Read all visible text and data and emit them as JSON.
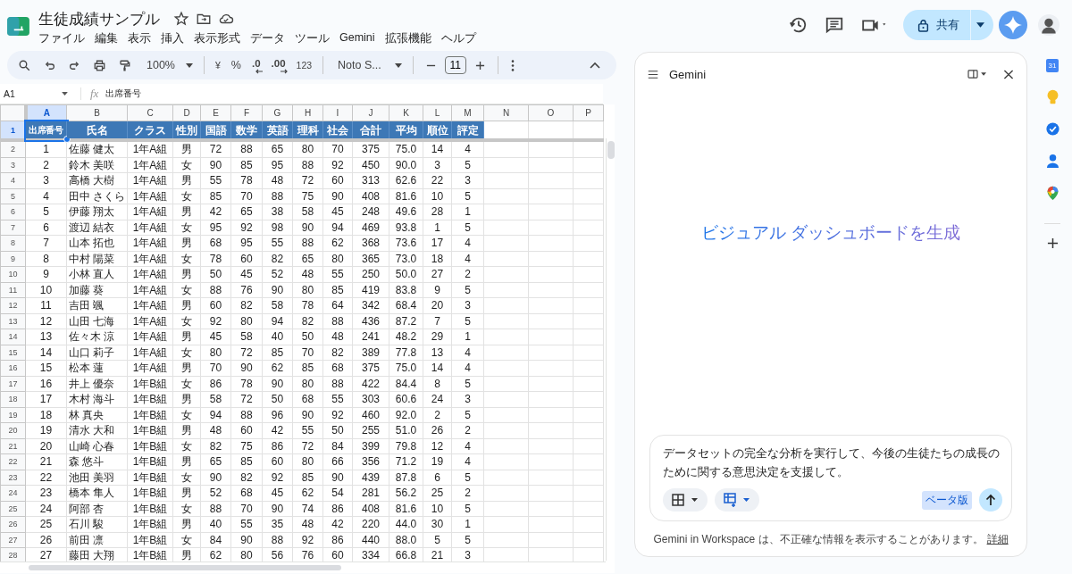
{
  "document": {
    "title": "生徒成績サンプル"
  },
  "menu": [
    "ファイル",
    "編集",
    "表示",
    "挿入",
    "表示形式",
    "データ",
    "ツール",
    "Gemini",
    "拡張機能",
    "ヘルプ"
  ],
  "share": {
    "label": "共有"
  },
  "toolbar": {
    "zoom": "100%",
    "currency": "¥",
    "percent": "%",
    "decrease_decimal": ".0",
    "increase_decimal": ".00",
    "number_format": "123",
    "font": "Noto S...",
    "font_size": "11"
  },
  "formula_bar": {
    "cell_ref": "A1",
    "fx": "fx",
    "value": "出席番号"
  },
  "sheet": {
    "columns": [
      {
        "letter": "A",
        "selected": true
      },
      {
        "letter": "B",
        "selected": false
      },
      {
        "letter": "C",
        "selected": false
      },
      {
        "letter": "D",
        "selected": false
      },
      {
        "letter": "E",
        "selected": false
      },
      {
        "letter": "F",
        "selected": false
      },
      {
        "letter": "G",
        "selected": false
      },
      {
        "letter": "H",
        "selected": false
      },
      {
        "letter": "I",
        "selected": false
      },
      {
        "letter": "J",
        "selected": false
      },
      {
        "letter": "K",
        "selected": false
      },
      {
        "letter": "L",
        "selected": false
      },
      {
        "letter": "M",
        "selected": false
      },
      {
        "letter": "N",
        "selected": false
      },
      {
        "letter": "O",
        "selected": false
      },
      {
        "letter": "P",
        "selected": false
      }
    ],
    "header": {
      "number": "1",
      "selected": true,
      "cells": [
        "出席番号",
        "氏名",
        "クラス",
        "性別",
        "国語",
        "数学",
        "英語",
        "理科",
        "社会",
        "合計",
        "平均",
        "順位",
        "評定"
      ]
    },
    "rows": [
      {
        "number": "2",
        "selected": false,
        "cells": [
          "1",
          "佐藤 健太",
          "1年A組",
          "男",
          "72",
          "88",
          "65",
          "80",
          "70",
          "375",
          "75.0",
          "14",
          "4"
        ]
      },
      {
        "number": "3",
        "selected": false,
        "cells": [
          "2",
          "鈴木 美咲",
          "1年A組",
          "女",
          "90",
          "85",
          "95",
          "88",
          "92",
          "450",
          "90.0",
          "3",
          "5"
        ]
      },
      {
        "number": "4",
        "selected": false,
        "cells": [
          "3",
          "高橋 大樹",
          "1年A組",
          "男",
          "55",
          "78",
          "48",
          "72",
          "60",
          "313",
          "62.6",
          "22",
          "3"
        ]
      },
      {
        "number": "5",
        "selected": false,
        "cells": [
          "4",
          "田中 さくら",
          "1年A組",
          "女",
          "85",
          "70",
          "88",
          "75",
          "90",
          "408",
          "81.6",
          "10",
          "5"
        ]
      },
      {
        "number": "6",
        "selected": false,
        "cells": [
          "5",
          "伊藤 翔太",
          "1年A組",
          "男",
          "42",
          "65",
          "38",
          "58",
          "45",
          "248",
          "49.6",
          "28",
          "1"
        ]
      },
      {
        "number": "7",
        "selected": false,
        "cells": [
          "6",
          "渡辺 結衣",
          "1年A組",
          "女",
          "95",
          "92",
          "98",
          "90",
          "94",
          "469",
          "93.8",
          "1",
          "5"
        ]
      },
      {
        "number": "8",
        "selected": false,
        "cells": [
          "7",
          "山本 拓也",
          "1年A組",
          "男",
          "68",
          "95",
          "55",
          "88",
          "62",
          "368",
          "73.6",
          "17",
          "4"
        ]
      },
      {
        "number": "9",
        "selected": false,
        "cells": [
          "8",
          "中村 陽菜",
          "1年A組",
          "女",
          "78",
          "60",
          "82",
          "65",
          "80",
          "365",
          "73.0",
          "18",
          "4"
        ]
      },
      {
        "number": "10",
        "selected": false,
        "cells": [
          "9",
          "小林 直人",
          "1年A組",
          "男",
          "50",
          "45",
          "52",
          "48",
          "55",
          "250",
          "50.0",
          "27",
          "2"
        ]
      },
      {
        "number": "11",
        "selected": false,
        "cells": [
          "10",
          "加藤 葵",
          "1年A組",
          "女",
          "88",
          "76",
          "90",
          "80",
          "85",
          "419",
          "83.8",
          "9",
          "5"
        ]
      },
      {
        "number": "12",
        "selected": false,
        "cells": [
          "11",
          "吉田 颯",
          "1年A組",
          "男",
          "60",
          "82",
          "58",
          "78",
          "64",
          "342",
          "68.4",
          "20",
          "3"
        ]
      },
      {
        "number": "13",
        "selected": false,
        "cells": [
          "12",
          "山田 七海",
          "1年A組",
          "女",
          "92",
          "80",
          "94",
          "82",
          "88",
          "436",
          "87.2",
          "7",
          "5"
        ]
      },
      {
        "number": "14",
        "selected": false,
        "cells": [
          "13",
          "佐々木 涼",
          "1年A組",
          "男",
          "45",
          "58",
          "40",
          "50",
          "48",
          "241",
          "48.2",
          "29",
          "1"
        ]
      },
      {
        "number": "15",
        "selected": false,
        "cells": [
          "14",
          "山口 莉子",
          "1年A組",
          "女",
          "80",
          "72",
          "85",
          "70",
          "82",
          "389",
          "77.8",
          "13",
          "4"
        ]
      },
      {
        "number": "16",
        "selected": false,
        "cells": [
          "15",
          "松本 蓮",
          "1年A組",
          "男",
          "70",
          "90",
          "62",
          "85",
          "68",
          "375",
          "75.0",
          "14",
          "4"
        ]
      },
      {
        "number": "17",
        "selected": false,
        "cells": [
          "16",
          "井上 優奈",
          "1年B組",
          "女",
          "86",
          "78",
          "90",
          "80",
          "88",
          "422",
          "84.4",
          "8",
          "5"
        ]
      },
      {
        "number": "18",
        "selected": false,
        "cells": [
          "17",
          "木村 海斗",
          "1年B組",
          "男",
          "58",
          "72",
          "50",
          "68",
          "55",
          "303",
          "60.6",
          "24",
          "3"
        ]
      },
      {
        "number": "19",
        "selected": false,
        "cells": [
          "18",
          "林 真央",
          "1年B組",
          "女",
          "94",
          "88",
          "96",
          "90",
          "92",
          "460",
          "92.0",
          "2",
          "5"
        ]
      },
      {
        "number": "20",
        "selected": false,
        "cells": [
          "19",
          "清水 大和",
          "1年B組",
          "男",
          "48",
          "60",
          "42",
          "55",
          "50",
          "255",
          "51.0",
          "26",
          "2"
        ]
      },
      {
        "number": "21",
        "selected": false,
        "cells": [
          "20",
          "山崎 心春",
          "1年B組",
          "女",
          "82",
          "75",
          "86",
          "72",
          "84",
          "399",
          "79.8",
          "12",
          "4"
        ]
      },
      {
        "number": "22",
        "selected": false,
        "cells": [
          "21",
          "森 悠斗",
          "1年B組",
          "男",
          "65",
          "85",
          "60",
          "80",
          "66",
          "356",
          "71.2",
          "19",
          "4"
        ]
      },
      {
        "number": "23",
        "selected": false,
        "cells": [
          "22",
          "池田 美羽",
          "1年B組",
          "女",
          "90",
          "82",
          "92",
          "85",
          "90",
          "439",
          "87.8",
          "6",
          "5"
        ]
      },
      {
        "number": "24",
        "selected": false,
        "cells": [
          "23",
          "橋本 隼人",
          "1年B組",
          "男",
          "52",
          "68",
          "45",
          "62",
          "54",
          "281",
          "56.2",
          "25",
          "2"
        ]
      },
      {
        "number": "25",
        "selected": false,
        "cells": [
          "24",
          "阿部 杏",
          "1年B組",
          "女",
          "88",
          "70",
          "90",
          "74",
          "86",
          "408",
          "81.6",
          "10",
          "5"
        ]
      },
      {
        "number": "26",
        "selected": false,
        "cells": [
          "25",
          "石川 駿",
          "1年B組",
          "男",
          "40",
          "55",
          "35",
          "48",
          "42",
          "220",
          "44.0",
          "30",
          "1"
        ]
      },
      {
        "number": "27",
        "selected": false,
        "cells": [
          "26",
          "前田 凛",
          "1年B組",
          "女",
          "84",
          "90",
          "88",
          "92",
          "86",
          "440",
          "88.0",
          "5",
          "5"
        ]
      },
      {
        "number": "28",
        "selected": false,
        "cells": [
          "27",
          "藤田 大翔",
          "1年B組",
          "男",
          "62",
          "80",
          "56",
          "76",
          "60",
          "334",
          "66.8",
          "21",
          "3"
        ]
      }
    ]
  },
  "gemini": {
    "title": "Gemini",
    "headline": "ビジュアル ダッシュボードを生成",
    "prompt": "データセットの完全な分析を実行して、今後の生徒たちの成長のために関する意思決定を支援して。",
    "badge": "ベータ版",
    "disclaimer": "Gemini in Workspace は、不正確な情報を表示することがあります。",
    "link": "詳細"
  },
  "side_panel": {
    "calendar_day": "31"
  }
}
